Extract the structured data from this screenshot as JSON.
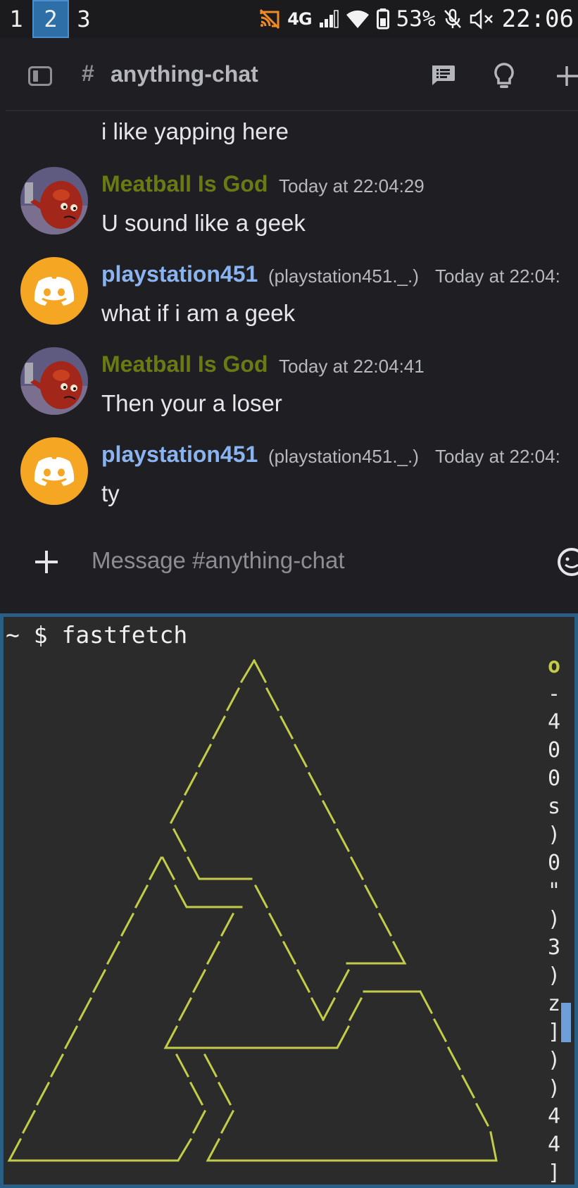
{
  "status_bar": {
    "workspaces": [
      "1",
      "2",
      "3"
    ],
    "active_workspace": "2",
    "network": "4G",
    "battery": "53%",
    "clock": "22:06",
    "icons": [
      "cast-off-icon",
      "signal-icon",
      "wifi-icon",
      "battery-icon",
      "mic-off-icon",
      "volume-muted-icon"
    ]
  },
  "channel": {
    "hash": "#",
    "name": "anything-chat"
  },
  "messages": [
    {
      "type": "continuation",
      "text": "i like yapping here"
    },
    {
      "type": "full",
      "user": "Meatball Is God",
      "user_color": "#6b7a12",
      "handle": "",
      "time": "Today at 22:04:29",
      "text": "U sound like a geek",
      "avatar": "meatball-avatar"
    },
    {
      "type": "full",
      "user": "playstation451",
      "user_color": "#8ab4f0",
      "handle": "(playstation451._.)",
      "time": "Today at 22:04:",
      "text": "what if i am a geek",
      "avatar": "discord-default-avatar"
    },
    {
      "type": "full",
      "user": "Meatball Is God",
      "user_color": "#6b7a12",
      "handle": "",
      "time": "Today at 22:04:41",
      "text": "Then your a loser",
      "avatar": "meatball-avatar"
    },
    {
      "type": "full",
      "user": "playstation451",
      "user_color": "#8ab4f0",
      "handle": "(playstation451._.)",
      "time": "Today at 22:04:",
      "text": "ty",
      "avatar": "discord-default-avatar"
    }
  ],
  "composer": {
    "placeholder": "Message #anything-chat"
  },
  "terminal": {
    "prompt": "~ $ fastfetch",
    "logo_color": "#c2cc47",
    "side_column": [
      "o",
      "-",
      "4",
      "0",
      "0",
      "s",
      ")",
      "0",
      "\"",
      ")",
      "3",
      ")",
      "z",
      "]",
      ")",
      ")",
      "4",
      "4",
      "]"
    ]
  },
  "colors": {
    "accent": "#2e6fa8",
    "terminal_border": "#2a5e85",
    "discord_orange": "#f5a623"
  }
}
